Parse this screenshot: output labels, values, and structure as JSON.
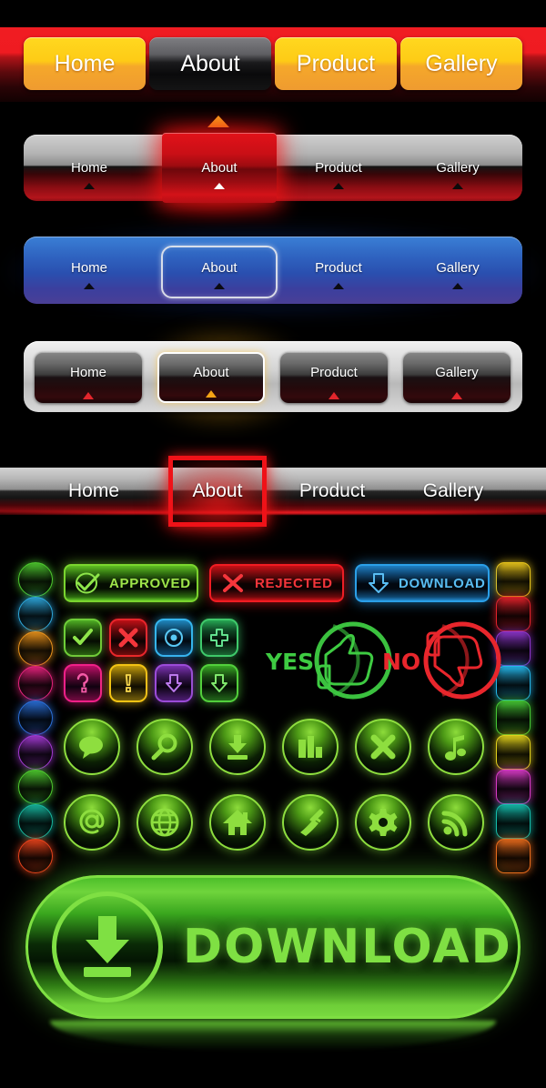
{
  "navs": [
    {
      "id": "nav-yellow-red",
      "style": "yellow-buttons-on-red",
      "items": [
        {
          "label": "Home",
          "active": false
        },
        {
          "label": "About",
          "active": true
        },
        {
          "label": "Product",
          "active": false
        },
        {
          "label": "Gallery",
          "active": false
        }
      ]
    },
    {
      "id": "nav-silver-red",
      "style": "silver-top-red-bottom",
      "items": [
        {
          "label": "Home",
          "active": false
        },
        {
          "label": "About",
          "active": true
        },
        {
          "label": "Product",
          "active": false
        },
        {
          "label": "Gallery",
          "active": false
        }
      ]
    },
    {
      "id": "nav-blue",
      "style": "blue-gradient-bar",
      "items": [
        {
          "label": "Home",
          "active": false
        },
        {
          "label": "About",
          "active": true
        },
        {
          "label": "Product",
          "active": false
        },
        {
          "label": "Gallery",
          "active": false
        }
      ]
    },
    {
      "id": "nav-silver-frame",
      "style": "silver-frame-dark-buttons",
      "items": [
        {
          "label": "Home",
          "active": false
        },
        {
          "label": "About",
          "active": true
        },
        {
          "label": "Product",
          "active": false
        },
        {
          "label": "Gallery",
          "active": false
        }
      ]
    },
    {
      "id": "nav-wide-strip",
      "style": "wide-metal-strip-red-selection",
      "items": [
        {
          "label": "Home",
          "active": false
        },
        {
          "label": "About",
          "active": true
        },
        {
          "label": "Product",
          "active": false
        },
        {
          "label": "Gallery",
          "active": false
        }
      ]
    }
  ],
  "neon_panel": {
    "pills": [
      {
        "label": "APPROVED",
        "icon": "check-icon",
        "color": "#7ad52f"
      },
      {
        "label": "REJECTED",
        "icon": "cross-icon",
        "color": "#f01c22"
      },
      {
        "label": "DOWNLOAD",
        "icon": "download-arrow-icon",
        "color": "#2b9fe8"
      }
    ],
    "square_icons": [
      {
        "icon": "check-icon",
        "color": "#6ece38"
      },
      {
        "icon": "cross-icon",
        "color": "#e8252b"
      },
      {
        "icon": "record-icon",
        "color": "#35b5ef"
      },
      {
        "icon": "plus-icon",
        "color": "#3fc96b"
      },
      {
        "icon": "question-icon",
        "color": "#ef2088"
      },
      {
        "icon": "exclamation-icon",
        "color": "#f2c314"
      },
      {
        "icon": "arrow-down-icon",
        "color": "#9b4bd8"
      },
      {
        "icon": "arrow-down-icon",
        "color": "#52cf3c"
      }
    ],
    "verdicts": [
      {
        "label": "YES",
        "icon": "thumbs-up-icon",
        "color": "#3ecb42"
      },
      {
        "label": "NO",
        "icon": "thumbs-down-icon",
        "color": "#e8262c"
      }
    ],
    "circle_icons_row1": [
      {
        "icon": "speech-bubble-icon"
      },
      {
        "icon": "search-icon"
      },
      {
        "icon": "download-icon"
      },
      {
        "icon": "bar-chart-icon"
      },
      {
        "icon": "close-x-icon"
      },
      {
        "icon": "music-note-icon"
      }
    ],
    "circle_icons_row2": [
      {
        "icon": "at-sign-icon"
      },
      {
        "icon": "globe-icon"
      },
      {
        "icon": "home-icon"
      },
      {
        "icon": "phone-icon"
      },
      {
        "icon": "gear-icon"
      },
      {
        "icon": "rss-icon"
      }
    ],
    "left_circles": [
      "#4ec92f",
      "#2ea8dd",
      "#e8921c",
      "#e8237e",
      "#2a6fd8",
      "#a43ad4",
      "#4ec92f",
      "#18b8a0",
      "#e8431c"
    ],
    "right_squares": [
      "#e8c41c",
      "#e0222a",
      "#8b35c9",
      "#25b5e8",
      "#45c634",
      "#e0cf1c",
      "#d63ac4",
      "#15bcab",
      "#e86b1c"
    ]
  },
  "big_download": {
    "label": "DOWNLOAD",
    "icon": "download-tray-icon",
    "color": "#7fe043"
  }
}
